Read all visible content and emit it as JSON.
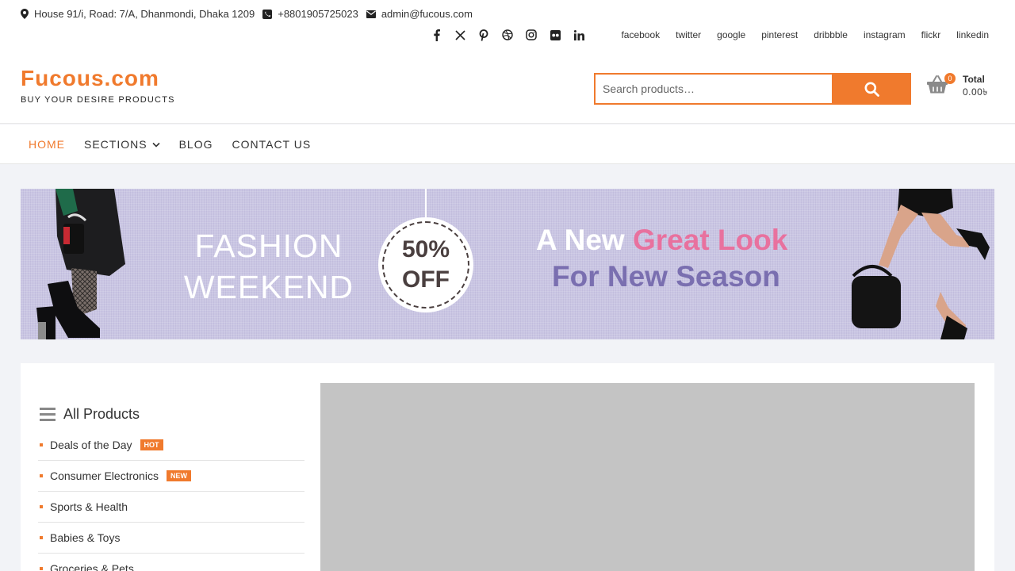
{
  "topbar": {
    "address": "House 91/i, Road: 7/A, Dhanmondi, Dhaka 1209",
    "phone": "+8801905725023",
    "email": "admin@fucous.com",
    "social_icons": [
      "facebook-icon",
      "x-twitter-icon",
      "pinterest-icon",
      "dribbble-icon",
      "instagram-icon",
      "flickr-icon",
      "linkedin-icon"
    ],
    "social_links": [
      "facebook",
      "twitter",
      "google",
      "pinterest",
      "dribbble",
      "instagram",
      "flickr",
      "linkedin"
    ]
  },
  "header": {
    "logo_title": "Fucous.com",
    "logo_tagline": "BUY YOUR DESIRE PRODUCTS",
    "search_placeholder": "Search products…",
    "cart_count": "0",
    "cart_total_label": "Total",
    "cart_total_value": "0.00৳"
  },
  "nav": {
    "items": [
      {
        "label": "HOME",
        "active": true
      },
      {
        "label": "SECTIONS",
        "dropdown": true
      },
      {
        "label": "BLOG"
      },
      {
        "label": "CONTACT US"
      }
    ]
  },
  "banner": {
    "fashion_line1": "FASHION",
    "fashion_line2": "WEEKEND",
    "discount_line1": "50%",
    "discount_line2": "OFF",
    "headline_a": "A New ",
    "headline_b": "Great Look",
    "headline_c": "For New Season"
  },
  "categories": {
    "title": "All Products",
    "items": [
      {
        "label": "Deals of the Day",
        "badge": "HOT"
      },
      {
        "label": "Consumer Electronics",
        "badge": "NEW"
      },
      {
        "label": "Sports & Health"
      },
      {
        "label": "Babies & Toys"
      },
      {
        "label": "Groceries & Pets"
      }
    ]
  },
  "colors": {
    "accent": "#f07a2d",
    "banner_bg": "#cac6e3",
    "pink": "#e8719e",
    "purple": "#7a6fb0"
  }
}
